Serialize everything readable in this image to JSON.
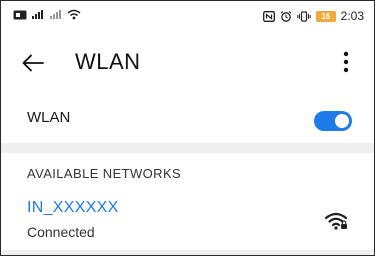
{
  "statusbar": {
    "left_icons": [
      "sim-icon",
      "signal-icon",
      "signal-icon",
      "wifi-icon"
    ],
    "right_icons": [
      "nfc-icon",
      "alarm-icon",
      "vibrate-icon"
    ],
    "battery_level": "16",
    "time": "2:03"
  },
  "header": {
    "title": "WLAN"
  },
  "wlan": {
    "label": "WLAN",
    "enabled": true
  },
  "networks": {
    "section_title": "AVAILABLE NETWORKS",
    "items": [
      {
        "name": "IN_XXXXXX",
        "status": "Connected"
      }
    ]
  },
  "colors": {
    "accent": "#1f7be8",
    "battery": "#f2a93b"
  }
}
